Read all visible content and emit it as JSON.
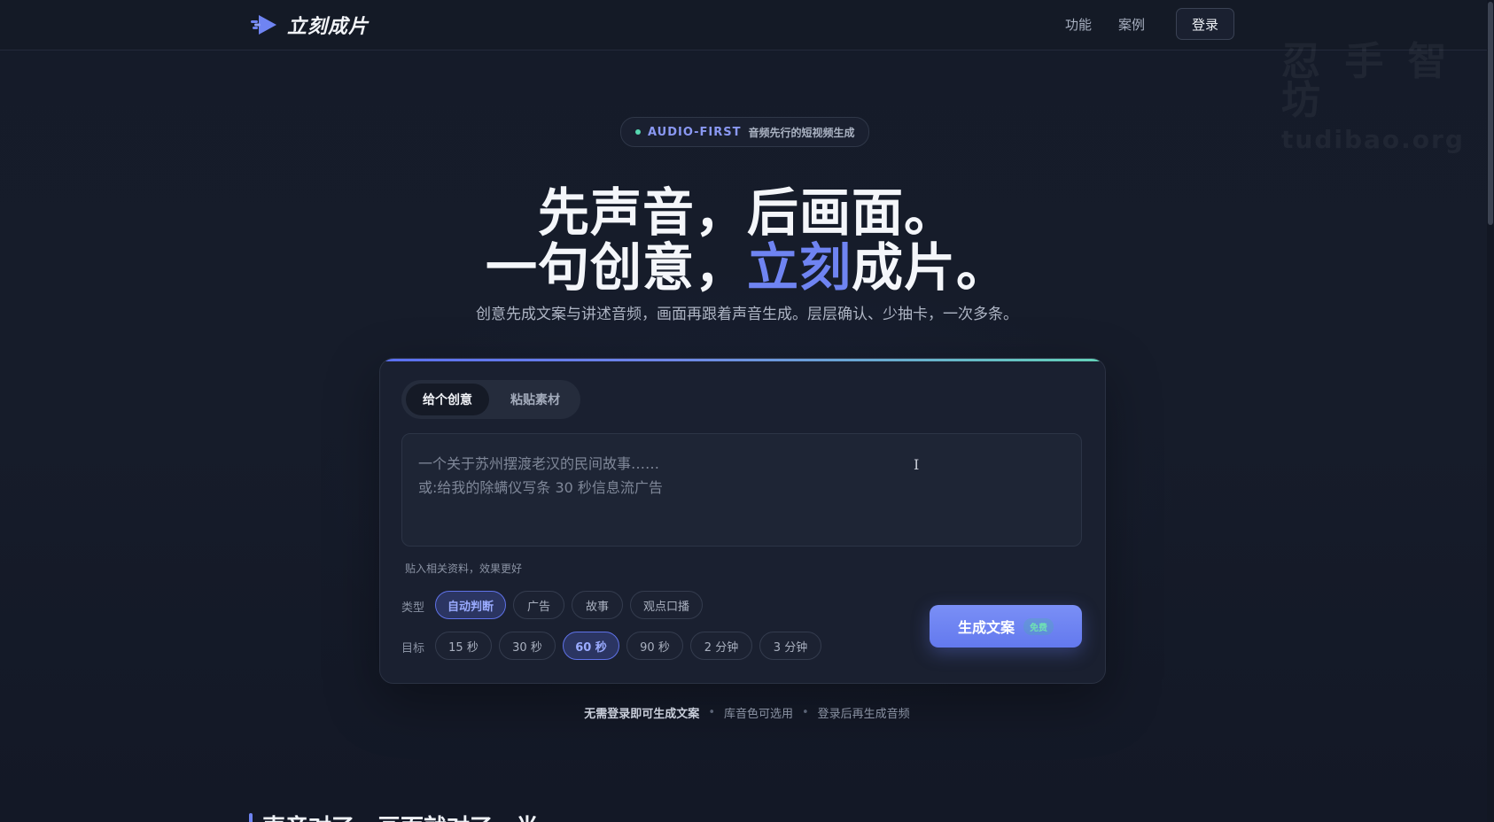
{
  "header": {
    "brand": "立刻成片",
    "nav": [
      "功能",
      "案例"
    ],
    "login": "登录"
  },
  "watermark": {
    "line1": "忍 手 智 坊",
    "line2": "tudibao.org"
  },
  "hero": {
    "badge_tag": "AUDIO-FIRST",
    "badge_text": "音频先行的短视频生成",
    "line1": "先声音，后画面。",
    "line2_prefix": "一句创意，",
    "line2_accent": "立刻",
    "line2_suffix": "成片。",
    "subtitle": "创意先成文案与讲述音频，画面再跟着声音生成。层层确认、少抽卡，一次多条。"
  },
  "card": {
    "tabs": [
      "给个创意",
      "粘贴素材"
    ],
    "active_tab": "给个创意",
    "input": {
      "placeholder_line1": "一个关于苏州摆渡老汉的民间故事……",
      "placeholder_line2": "或:给我的除螨仪写条 30 秒信息流广告",
      "value": ""
    },
    "hint": "贴入相关资料，效果更好",
    "type_label": "类型",
    "types": [
      "自动判断",
      "广告",
      "故事",
      "观点口播"
    ],
    "selected_type": "自动判断",
    "target_label": "目标",
    "targets": [
      "15 秒",
      "30 秒",
      "60 秒",
      "90 秒",
      "2 分钟",
      "3 分钟"
    ],
    "selected_target": "60 秒",
    "generate_label": "生成文案",
    "generate_badge": "免费"
  },
  "notes": {
    "strong": "无需登录即可生成文案",
    "item2": "库音色可选用",
    "item3": "登录后再生成音频",
    "separator": "•"
  },
  "section": {
    "title": "声音对了，画面就对了一半"
  },
  "colors": {
    "background": "#141a27",
    "accent": "#6f84f2",
    "success": "#56d7b0"
  }
}
